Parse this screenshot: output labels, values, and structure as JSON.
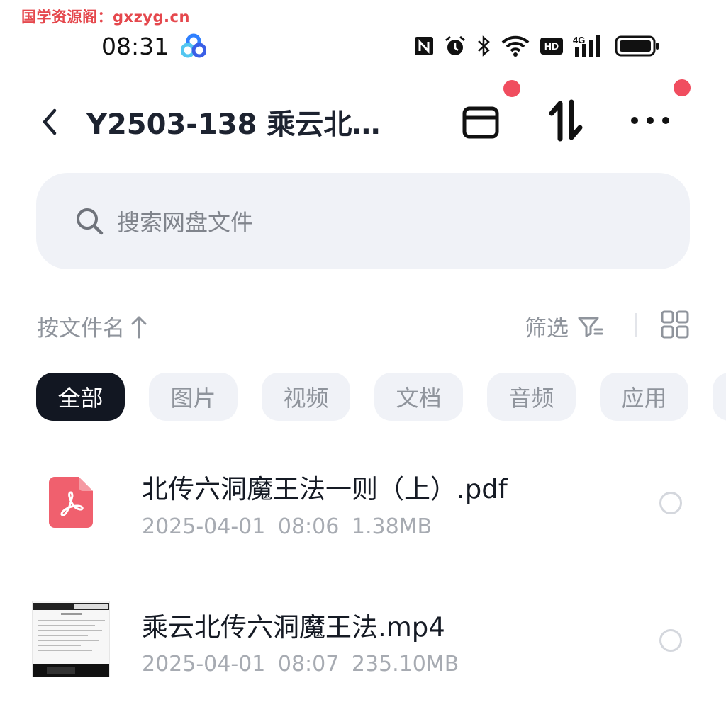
{
  "watermark": "国学资源阁：gxzyg.cn",
  "status_bar": {
    "time": "08:31",
    "icons": [
      "nfc-icon",
      "alarm-icon",
      "bluetooth-icon",
      "wifi-icon",
      "hd-icon",
      "signal-4g-icon",
      "battery-icon"
    ],
    "hd_label": "HD",
    "network_label": "4G",
    "battery_level": 0.85
  },
  "header": {
    "title": "Y2503-138 乘云北…",
    "notification_dots": true
  },
  "search": {
    "placeholder": "搜索网盘文件"
  },
  "sort": {
    "label": "按文件名",
    "direction": "ascending",
    "filter_label": "筛选"
  },
  "chips": [
    "全部",
    "图片",
    "视频",
    "文档",
    "音频",
    "应用"
  ],
  "active_chip": "全部",
  "files": [
    {
      "name": "北传六洞魔王法一则（上）.pdf",
      "meta": "2025-04-01  08:06  1.38MB",
      "type": "pdf",
      "selected": false
    },
    {
      "name": "乘云北传六洞魔王法.mp4",
      "meta": "2025-04-01  08:07  235.10MB",
      "type": "video",
      "selected": false
    }
  ],
  "colors": {
    "accent_dot": "#f04d5f",
    "active_chip_bg": "#121722",
    "pdf_icon": "#f0606e",
    "watermark": "#e5484d"
  }
}
